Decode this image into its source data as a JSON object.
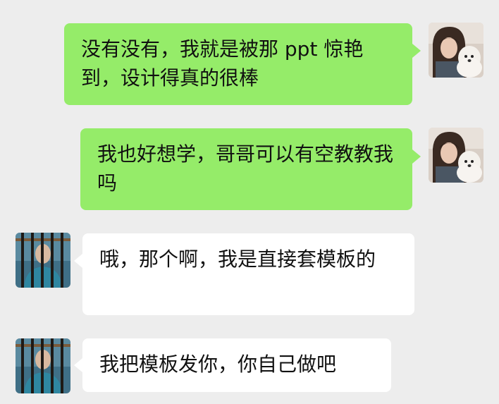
{
  "colors": {
    "background": "#ededed",
    "self_bubble": "#95ec69",
    "other_bubble": "#ffffff",
    "text": "#111111"
  },
  "messages": [
    {
      "sender": "self",
      "text": "没有没有，我就是被那 ppt 惊艳到，设计得真的很棒",
      "avatar_icon": "girl-with-dog-avatar"
    },
    {
      "sender": "self",
      "text": "我也好想学，哥哥可以有空教教我吗",
      "avatar_icon": "girl-with-dog-avatar"
    },
    {
      "sender": "other",
      "text": "哦，那个啊，我是直接套模板的",
      "avatar_icon": "man-behind-bars-avatar"
    },
    {
      "sender": "other",
      "text": "我把模板发你，你自己做吧",
      "avatar_icon": "man-behind-bars-avatar"
    }
  ]
}
